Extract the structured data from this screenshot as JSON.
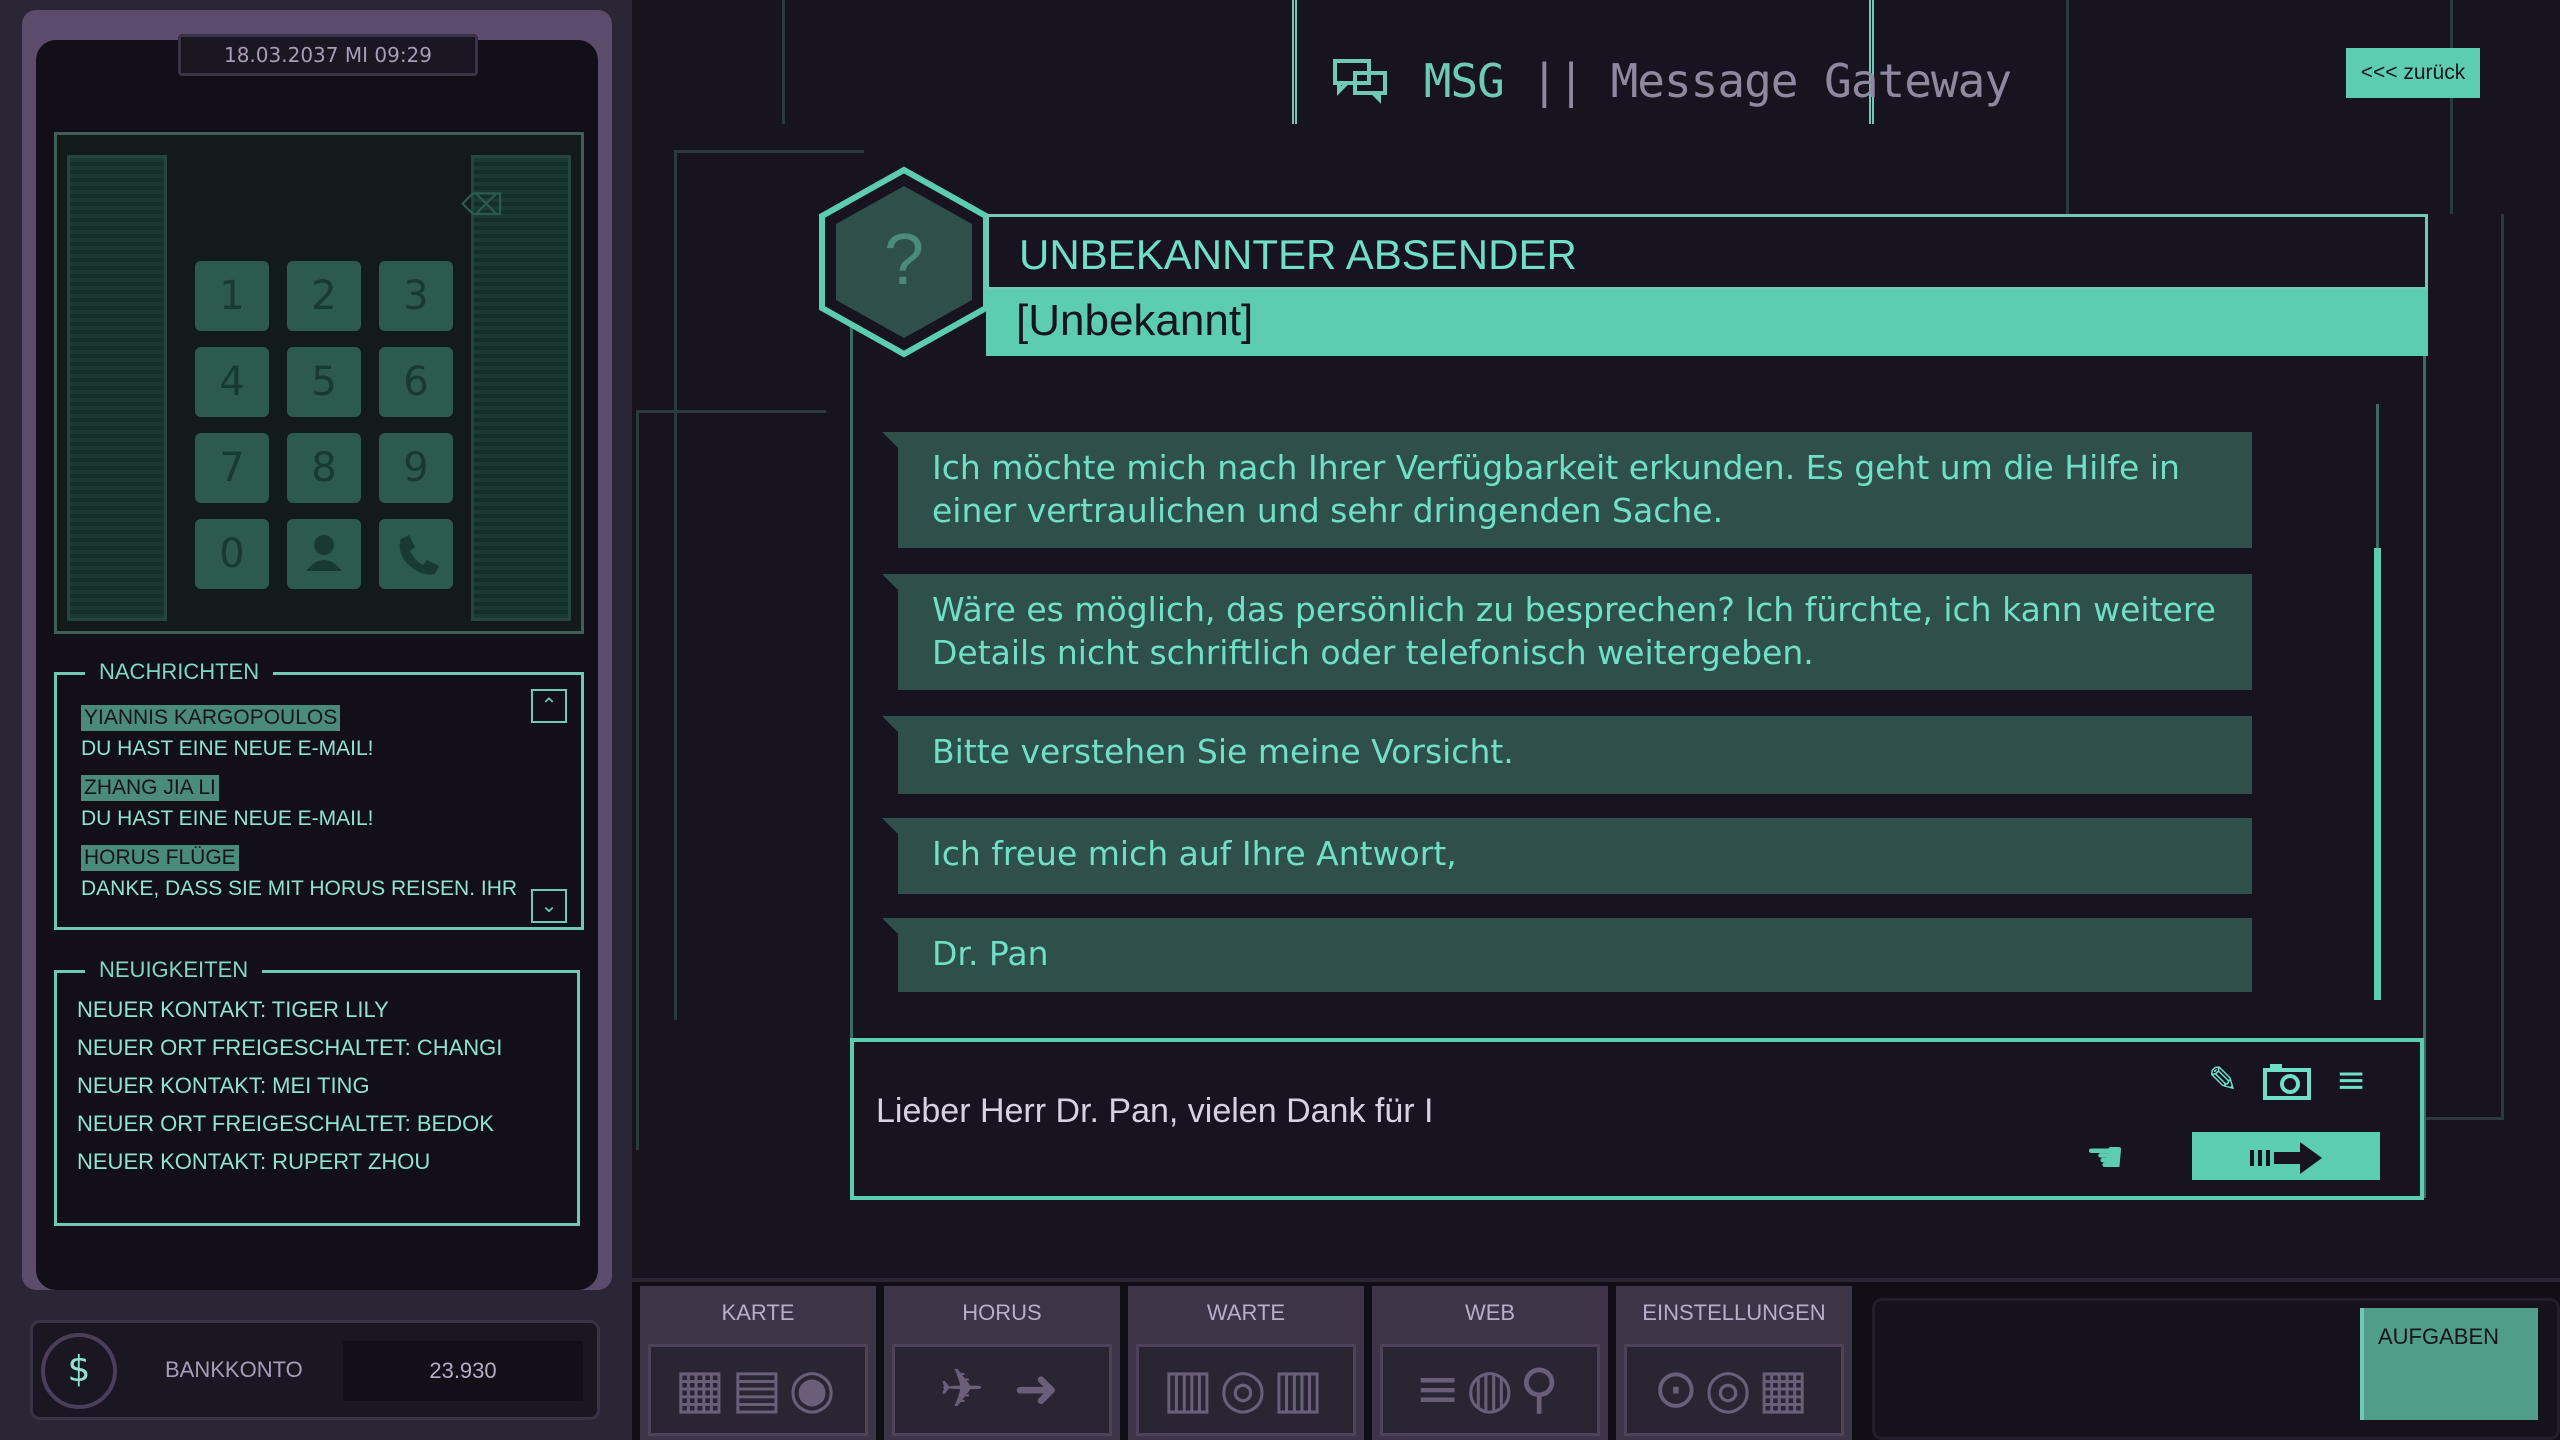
{
  "phone": {
    "datetime": "18.03.2037 MI 09:29",
    "keys": [
      "1",
      "2",
      "3",
      "4",
      "5",
      "6",
      "7",
      "8",
      "9",
      "0"
    ],
    "messages_title": "NACHRICHTEN",
    "messages": [
      {
        "sender": "YIANNIS KARGOPOULOS",
        "text": "DU HAST EINE NEUE E-MAIL!"
      },
      {
        "sender": "ZHANG JIA LI",
        "text": "DU HAST EINE NEUE E-MAIL!"
      },
      {
        "sender": "HORUS FLÜGE",
        "text": "DANKE, DASS SIE MIT HORUS REISEN. IHR"
      }
    ],
    "news_title": "NEUIGKEITEN",
    "news": [
      "NEUER KONTAKT: TIGER LILY",
      "NEUER ORT FREIGESCHALTET: CHANGI",
      "NEUER KONTAKT: MEI TING",
      "NEUER ORT FREIGESCHALTET: BEDOK",
      "NEUER KONTAKT: RUPERT ZHOU"
    ],
    "bank_label": "BANKKONTO",
    "bank_value": "23.930",
    "bank_icon": "$"
  },
  "header": {
    "app_short": "MSG",
    "separator": "||",
    "app_name": "Message Gateway",
    "back_label": "<<< zurück"
  },
  "conversation": {
    "avatar_symbol": "?",
    "sender_name": "UNBEKANNTER ABSENDER",
    "sender_sub": "[Unbekannt]",
    "messages": [
      "Ich möchte mich nach Ihrer Verfügbarkeit erkunden. Es geht um die Hilfe in einer vertraulichen und sehr dringenden Sache.",
      "Wäre es möglich, das persönlich zu besprechen? Ich fürchte, ich kann weitere Details nicht schriftlich oder telefonisch weitergeben.",
      "Bitte verstehen Sie meine Vorsicht.",
      "Ich freue mich auf Ihre Antwort,",
      "Dr. Pan"
    ],
    "composer_text": "Lieber Herr Dr. Pan, vielen Dank für I"
  },
  "dock": {
    "buttons": [
      "KARTE",
      "HORUS",
      "WARTE",
      "WEB",
      "EINSTELLUNGEN"
    ],
    "tasks_label": "AUFGABEN"
  },
  "colors": {
    "accent": "#5ccdb0",
    "background": "#17141f",
    "bubble": "#2f4f4b"
  }
}
